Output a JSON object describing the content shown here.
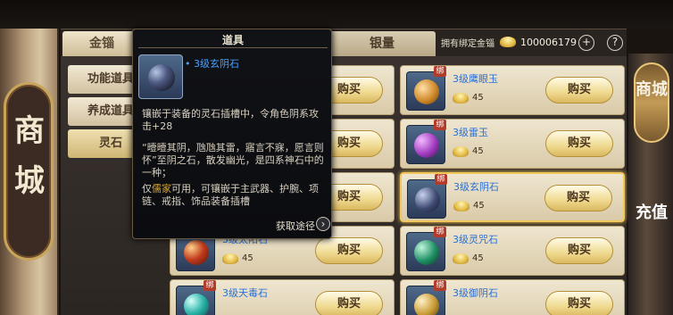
{
  "left_title_chars": [
    "商",
    "城"
  ],
  "tabs": {
    "gold": "金锱",
    "silver": "银量"
  },
  "currency": {
    "label": "拥有绑定金锱",
    "amount": "100006179",
    "plus": "+",
    "help": "?"
  },
  "categories": [
    "功能道具",
    "养成道具",
    "灵石"
  ],
  "tooltip": {
    "header": "道具",
    "item_name": "• 3级玄阴石",
    "desc_1": "镶嵌于装备的灵石插槽中，令角色阴系攻击+28",
    "desc_2": "“曀曀其阴，虺虺其雷，寤言不寐，愿言则怀”至阴之石，散发幽光，是四系神石中的一种；",
    "desc_3_prefix": "仅",
    "desc_3_highlight": "儒家",
    "desc_3_suffix": "可用，可镶嵌于主武器、护腕、项链、戒指、饰品装备插槽",
    "get_link": "获取途径",
    "arrow": "›"
  },
  "buy_label": "购买",
  "bind_label": "绑",
  "items_right": [
    {
      "name": "3级鹰眼玉",
      "price": "45",
      "color": "#d08a2a"
    },
    {
      "name": "3级雷玉",
      "price": "45",
      "color": "#a23cc0"
    },
    {
      "name": "3级玄阴石",
      "price": "45",
      "color": "#3f4b74"
    },
    {
      "name": "3级灵咒石",
      "price": "45",
      "color": "#1e8f63"
    },
    {
      "name": "3级御阴石",
      "price": "",
      "color": "#c89a33"
    }
  ],
  "items_left": [
    {
      "name": "",
      "price": "",
      "color": "#4b6fa4"
    },
    {
      "name": "",
      "price": "",
      "color": "#4b6fa4"
    },
    {
      "name": "",
      "price": "",
      "color": "#4b6fa4"
    },
    {
      "name": "3级太阳石",
      "price": "45",
      "color": "#c03a1c"
    },
    {
      "name": "3级天毒石",
      "price": "",
      "color": "#2ab3a8"
    }
  ],
  "right_buttons": {
    "shop": "商城",
    "recharge": "充值"
  }
}
